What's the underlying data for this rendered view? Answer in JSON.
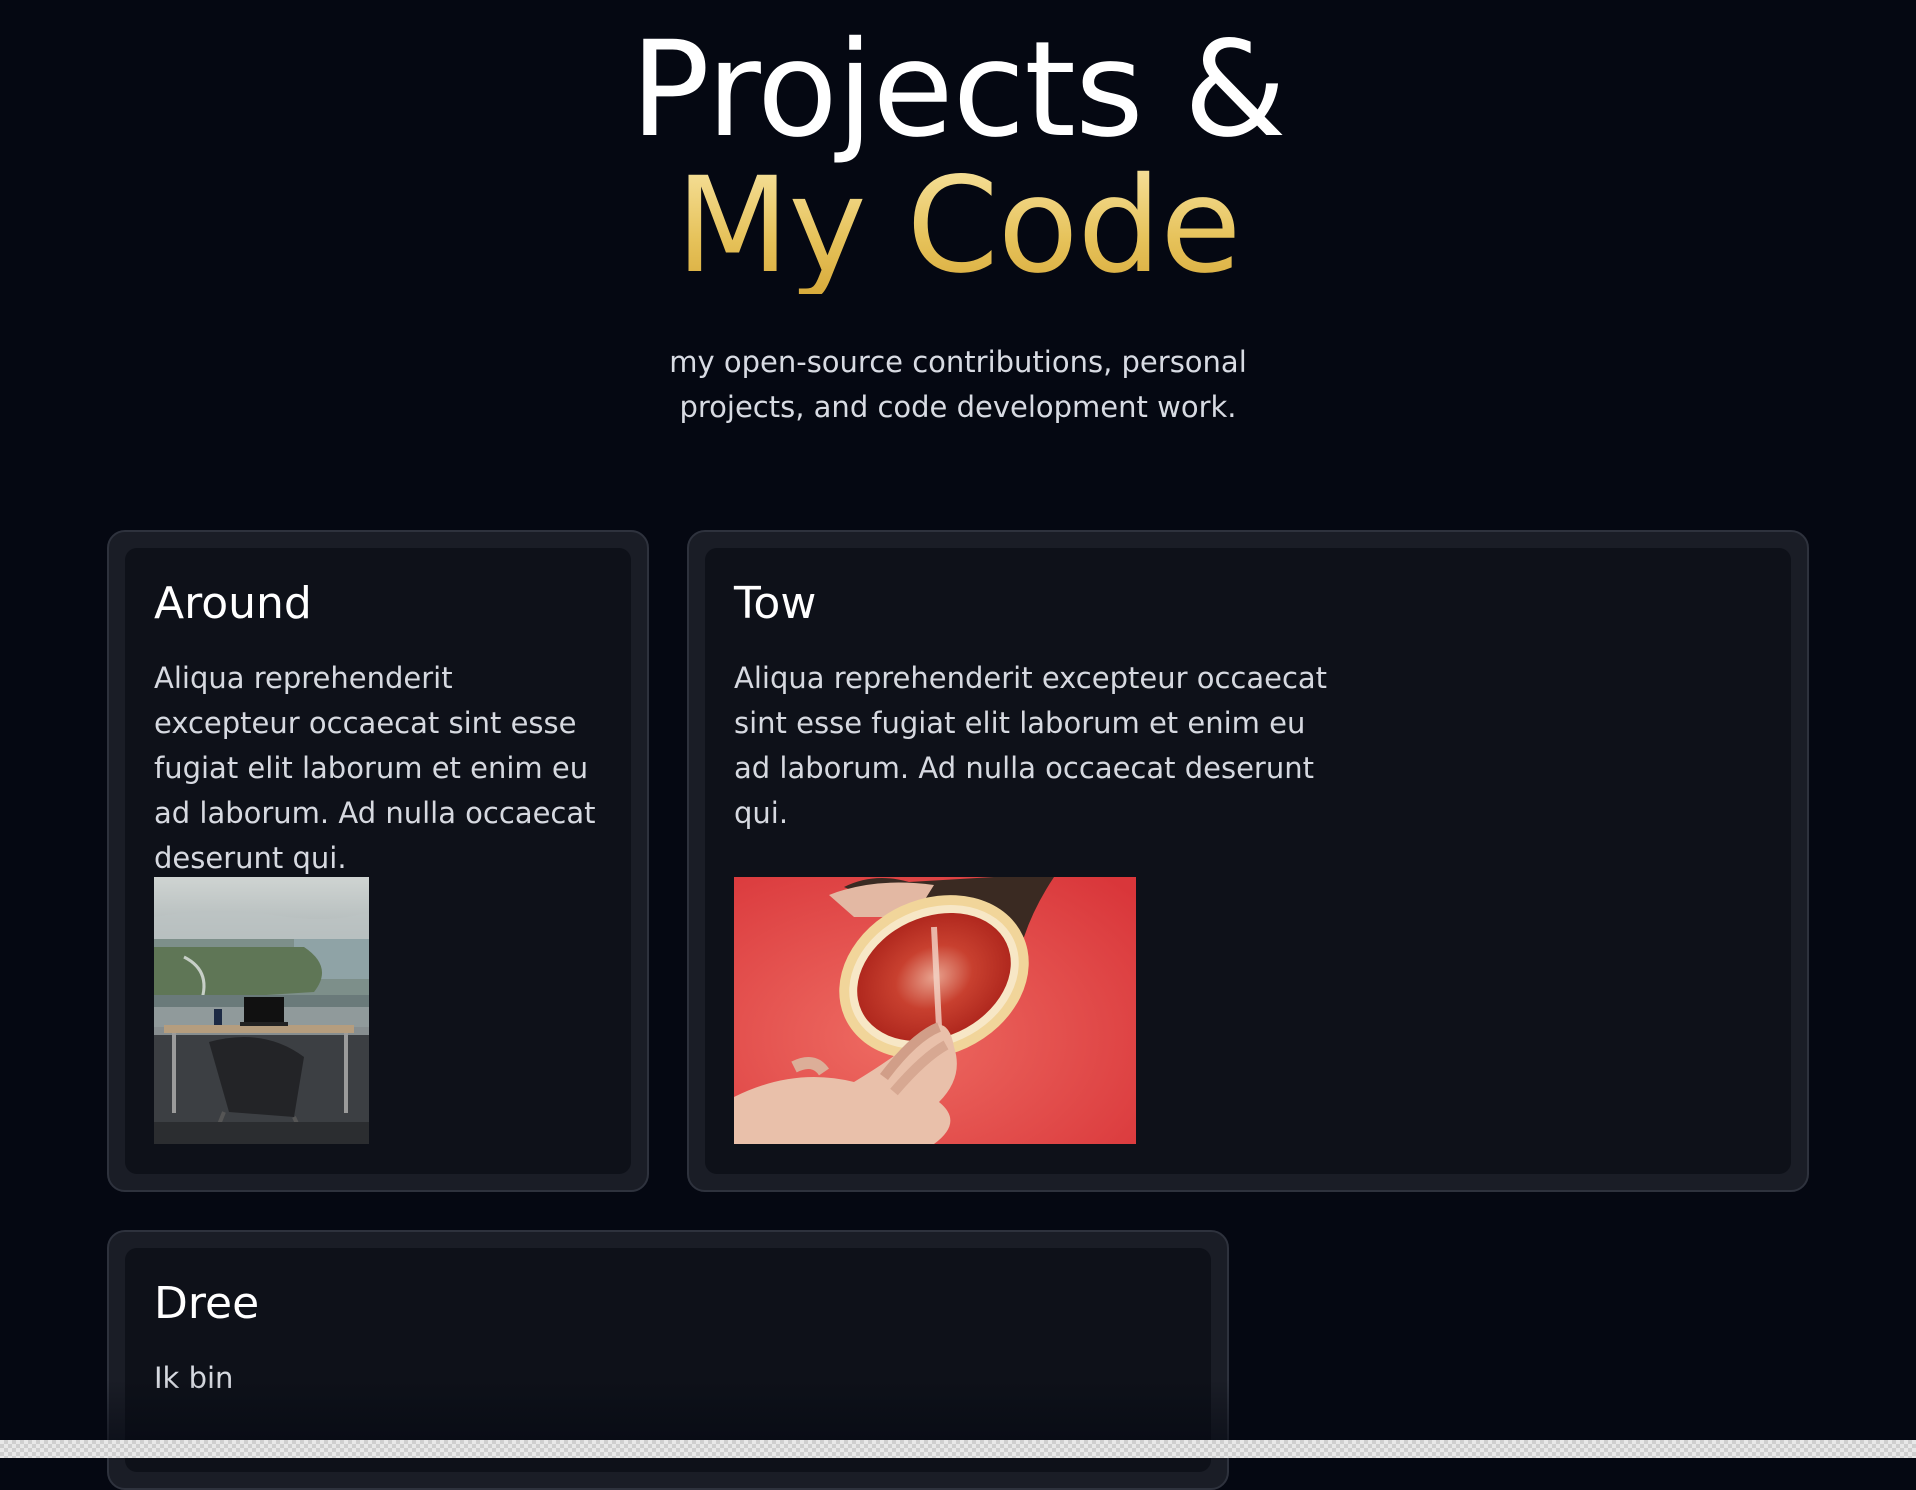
{
  "hero": {
    "title_line1": "Projects &",
    "title_line2": "My Code",
    "subtitle": "my open-source contributions, personal projects, and code development work."
  },
  "projects": [
    {
      "title": "Around",
      "description": "Aliqua reprehenderit excepteur occaecat sint esse fugiat elit laborum et enim eu ad laborum. Ad nulla occaecat deserunt qui.",
      "image": "office-desk-city-view-photo"
    },
    {
      "title": "Tow",
      "description": "Aliqua reprehenderit excepteur occaecat sint esse fugiat elit laborum et enim eu ad laborum. Ad nulla occaecat deserunt qui.",
      "image": "grapefruit-hands-photo"
    },
    {
      "title": "Dree",
      "description": "Ik bin"
    }
  ],
  "colors": {
    "background": "#050812",
    "accent_gold": "#e6c25a",
    "card_border": "#2e323d",
    "card_inner": "#0e1119"
  }
}
